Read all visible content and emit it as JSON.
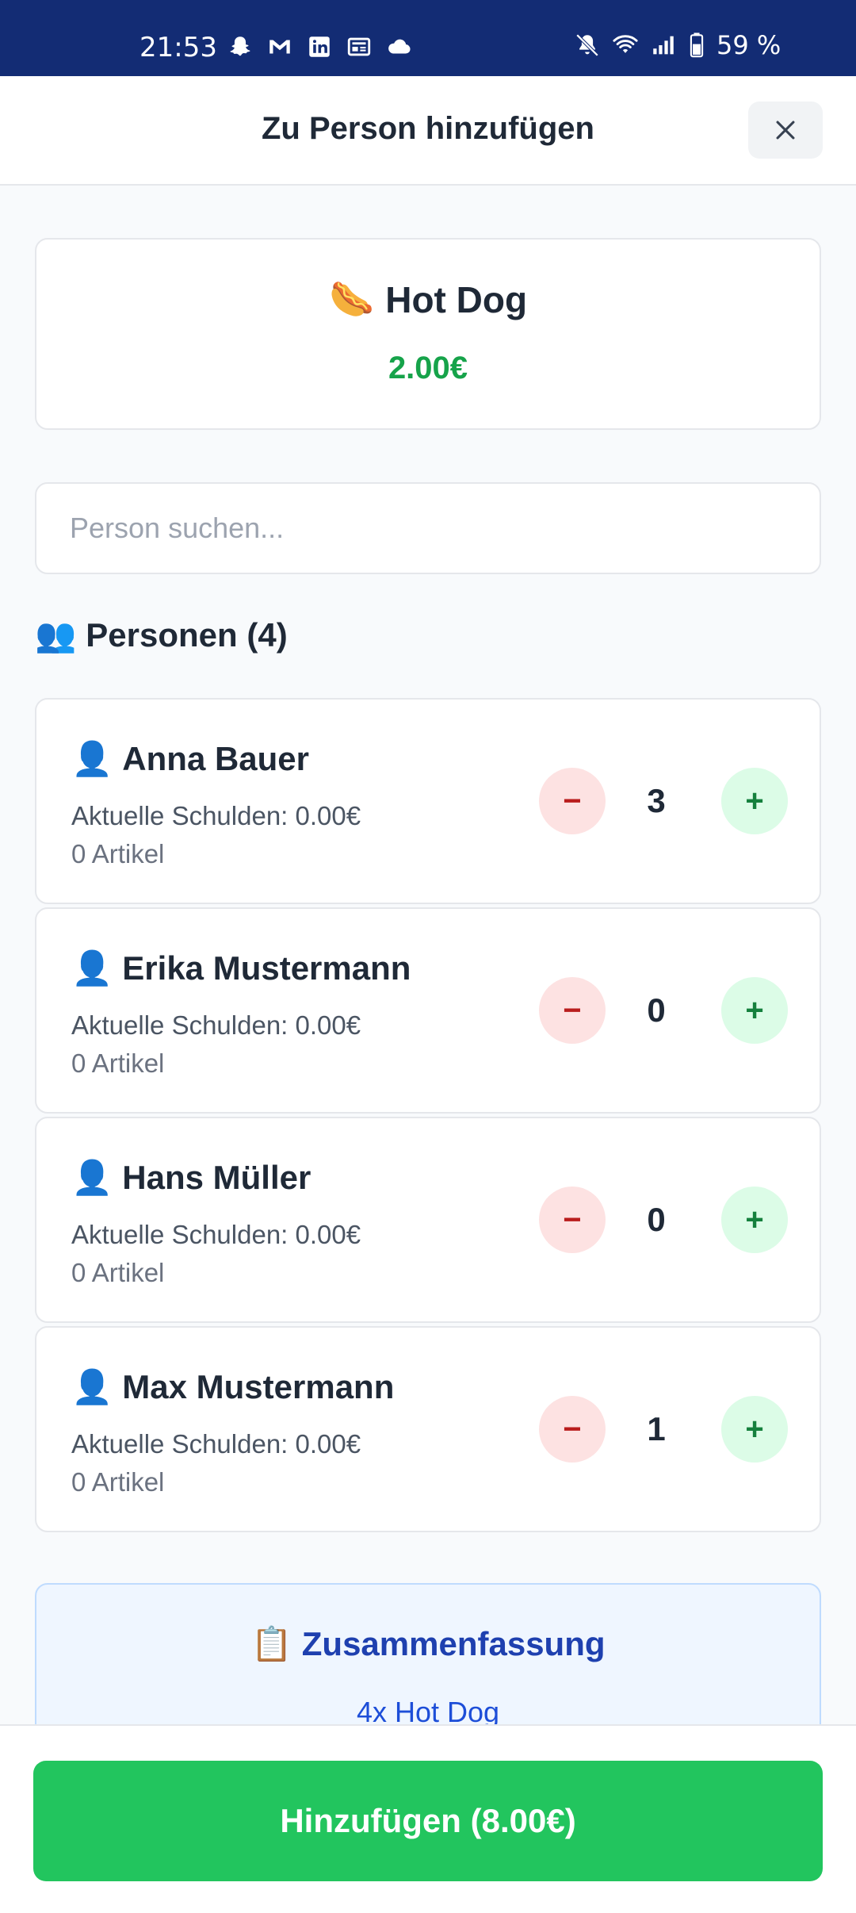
{
  "status_bar": {
    "time": "21:53",
    "battery_text": "59 %",
    "left_icons": [
      "snapchat-icon",
      "gmail-icon",
      "linkedin-icon",
      "news-icon",
      "cloud-icon"
    ],
    "right_icons": [
      "mute-icon",
      "wifi-icon",
      "signal-icon",
      "battery-icon"
    ]
  },
  "header": {
    "title": "Zu Person hinzufügen",
    "close_icon": "close-icon"
  },
  "product": {
    "emoji": "🌭",
    "name": "Hot Dog",
    "price": "2.00€"
  },
  "search": {
    "placeholder": "Person suchen..."
  },
  "persons_section": {
    "emoji": "👥",
    "title": "Personen (4)"
  },
  "persons": [
    {
      "emoji": "👤",
      "name": "Anna Bauer",
      "debt": "Aktuelle Schulden: 0.00€",
      "items": "0 Artikel",
      "quantity": "3",
      "minus": "−",
      "plus": "+"
    },
    {
      "emoji": "👤",
      "name": "Erika Mustermann",
      "debt": "Aktuelle Schulden: 0.00€",
      "items": "0 Artikel",
      "quantity": "0",
      "minus": "−",
      "plus": "+"
    },
    {
      "emoji": "👤",
      "name": "Hans Müller",
      "debt": "Aktuelle Schulden: 0.00€",
      "items": "0 Artikel",
      "quantity": "0",
      "minus": "−",
      "plus": "+"
    },
    {
      "emoji": "👤",
      "name": "Max Mustermann",
      "debt": "Aktuelle Schulden: 0.00€",
      "items": "0 Artikel",
      "quantity": "1",
      "minus": "−",
      "plus": "+"
    }
  ],
  "summary": {
    "emoji": "📋",
    "title": "Zusammenfassung",
    "line": "4x Hot Dog"
  },
  "footer": {
    "add_button": "Hinzufügen (8.00€)"
  },
  "colors": {
    "status_bar_bg": "#132c74",
    "price_green": "#16a34a",
    "add_button_green": "#22c55e",
    "minus_bg": "#fde2e2",
    "plus_bg": "#dcfce7",
    "summary_bg": "#eff6ff",
    "summary_text": "#1e40af"
  }
}
